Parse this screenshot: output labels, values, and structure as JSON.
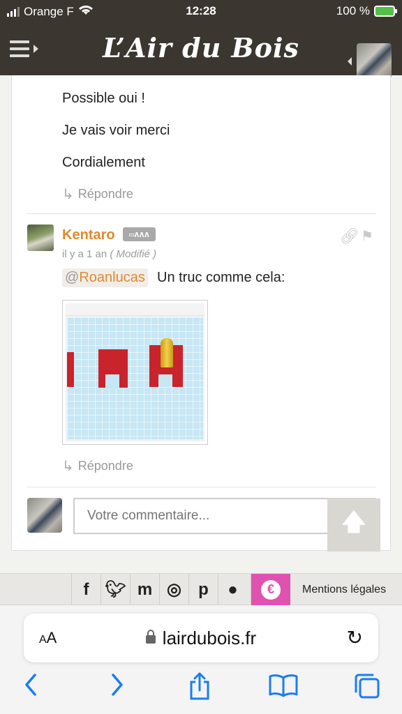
{
  "status_bar": {
    "carrier": "Orange F",
    "time": "12:28",
    "battery": "100 %"
  },
  "header": {
    "site_title": "L’Air du Bois",
    "menu_icon": "menu-icon",
    "user_icon": "user-avatar"
  },
  "thread": {
    "lines": [
      "Possible oui !",
      "Je vais voir merci",
      "Cordialement"
    ],
    "reply_label": "Répondre"
  },
  "comment": {
    "author": "Kentaro",
    "badge": "saw-badge",
    "meta_time": "il y a 1 an",
    "meta_modified": "( Modifié )",
    "mention_at": "@",
    "mention_user": "Roanlucas",
    "text": "Un truc comme cela:",
    "reply_label": "Répondre",
    "attachment": "tinkercad-screenshot"
  },
  "form": {
    "placeholder": "Votre commentaire..."
  },
  "footer": {
    "social": [
      "facebook-icon",
      "twitter-icon",
      "mastodon-icon",
      "instagram-icon",
      "pinterest-icon",
      "github-icon",
      "donate-icon"
    ],
    "legal_label": "Mentions légales"
  },
  "browser": {
    "aa_label": "AA",
    "url": "lairdubois.fr"
  },
  "colors": {
    "accent": "#e08a2c",
    "header_bg": "#3b3630",
    "donate": "#e052b0",
    "ios_blue": "#1a7cf5"
  }
}
